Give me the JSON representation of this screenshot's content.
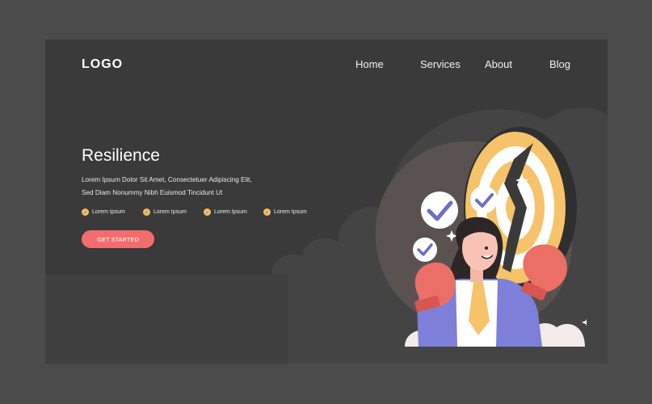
{
  "header": {
    "logo": "LOGO",
    "nav": [
      "Home",
      "Services",
      "About",
      "Blog"
    ]
  },
  "hero": {
    "title": "Resilience",
    "description": "Lorem Ipsum Dolor Sit Amet, Consectetuer Adipiscing Elit, Sed Diam Nonummy Nibh Euismod Tincidunt Ut",
    "features": [
      "Lorem Ipsum",
      "Lorem Ipsum",
      "Lorem Ipsum",
      "Lorem Ipsum"
    ],
    "cta": "GET STARTED"
  },
  "colors": {
    "page_bg": "#4b4b4b",
    "panel_bg": "#3a3a3a",
    "cloud": "#444444",
    "accent": "#f26d6d",
    "check_dot": "#f2c06a",
    "jacket": "#7d7fd8",
    "target": "#f6c36a"
  },
  "icons": [
    "check-circle-icon",
    "sparkle-icon",
    "boxing-glove-icon",
    "target-icon"
  ]
}
